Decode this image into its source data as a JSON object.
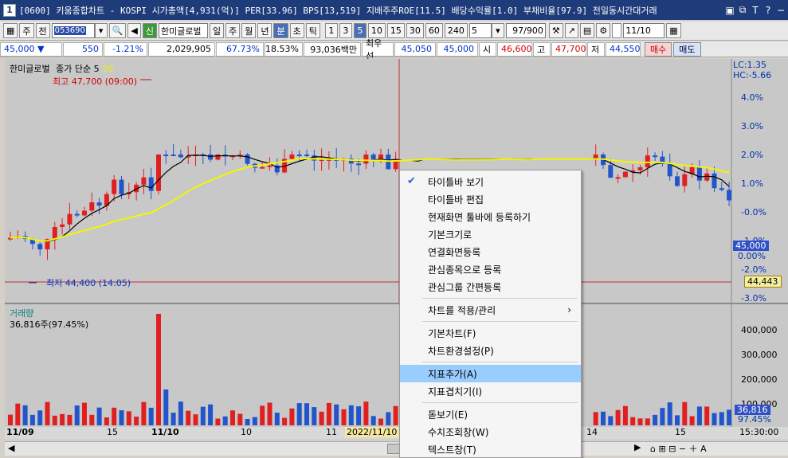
{
  "window": {
    "title_number": "1",
    "title": "[0600] 키움종합차트 - KOSPI 시가총액[4,931(억)] PER[33.96] BPS[13,519] 지배주주ROE[11.5] 배당수익률[1.0] 부채비율[97.9] 전일동시간대거래",
    "title_icons": [
      "window-icon",
      "restore-icon",
      "text-icon",
      "help-icon"
    ],
    "minimize_label": "−"
  },
  "toolbar": {
    "type_label": "주",
    "all_label": "전",
    "code": "053690",
    "stock_name": "한미글로벌",
    "period_buttons": [
      "일",
      "주",
      "월",
      "년",
      "분",
      "초",
      "틱"
    ],
    "minute_buttons": [
      "1",
      "3",
      "5",
      "10",
      "15",
      "30",
      "60",
      "240"
    ],
    "selected_minute": "5",
    "interval_value": "5",
    "count_value": "97",
    "count_total": "/900",
    "date_value": "11/10"
  },
  "quote": {
    "price": "45,000 ▼",
    "change": "550",
    "change_pct": "-1.21%",
    "volume": "2,029,905",
    "ratio": "67.73%",
    "ratio2": "18.53%",
    "amount": "93,036백만",
    "best_label": "최우선",
    "ask": "45,050",
    "bid": "45,000",
    "open_label": "시",
    "open": "46,600",
    "high_label": "고",
    "high": "47,700",
    "low_label": "저",
    "low": "44,550",
    "buy_label": "매수",
    "sell_label": "매도"
  },
  "chart": {
    "price_legend_name": "한미글로벌",
    "price_legend_ma": "종가 단순 5",
    "price_legend_ma_period": "20",
    "high_annotation": "최고 47,700 (09:00)",
    "low_annotation": "최저 44,400 (14:05)",
    "lc": "LC:1.35",
    "hc": "HC:-5.66",
    "price_ticks": [
      "4.0%",
      "3.0%",
      "2.0%",
      "1.0%",
      "-0.0%",
      "-1.0%",
      "-2.0%",
      "-3.0%"
    ],
    "current_price_tag": "45,000",
    "zero_tag": "0.00%",
    "line_tag": "44,443",
    "volume_legend": "거래량",
    "volume_value": "36,816주(97.45%)",
    "volume_ticks": [
      "400,000",
      "300,000",
      "200,000",
      "100,000"
    ],
    "volume_tag": "36,816",
    "volume_pct_tag": "97.45%",
    "date_labels": [
      "11/09",
      "15",
      "11/10",
      "10",
      "11",
      "2022/11/10",
      "14",
      "15"
    ],
    "time_label": "15:30:00"
  },
  "context_menu": {
    "items": [
      {
        "label": "타이틀바 보기",
        "checked": true
      },
      {
        "label": "타이틀바 편집"
      },
      {
        "label": "현재화면 툴바에 등록하기"
      },
      {
        "label": "기본크기로"
      },
      {
        "label": "연결화면등록"
      },
      {
        "label": "관심종목으로 등록"
      },
      {
        "label": "관심그룹 간편등록"
      },
      {
        "separator": true
      },
      {
        "label": "차트를 적용/관리",
        "submenu": true
      },
      {
        "separator": true
      },
      {
        "label": "기본차트(F)"
      },
      {
        "label": "차트환경설정(P)"
      },
      {
        "separator": true
      },
      {
        "label": "지표추가(A)",
        "highlighted": true
      },
      {
        "label": "지표겹치기(I)"
      },
      {
        "separator": true
      },
      {
        "label": "돋보기(E)"
      },
      {
        "label": "수치조회창(W)"
      },
      {
        "label": "텍스트창(T)"
      }
    ]
  },
  "colors": {
    "up": "#e02020",
    "down": "#2255cc",
    "ma5": "#000000",
    "ma20": "#f0f000",
    "title_bg": "#1f3c7a",
    "highlight": "#99ccff"
  }
}
